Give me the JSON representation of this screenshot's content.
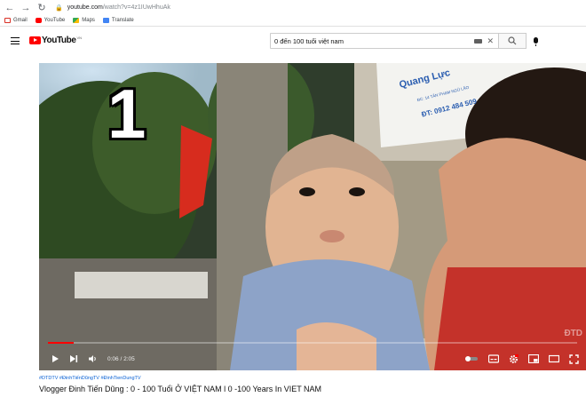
{
  "browser": {
    "url_host": "youtube.com",
    "url_path": "/watch?v=4z1IUwHhuAk",
    "bookmarks": [
      {
        "label": "Gmail",
        "icon": "gmail-icon",
        "color": "#d93025"
      },
      {
        "label": "YouTube",
        "icon": "youtube-icon",
        "color": "#ff0000"
      },
      {
        "label": "Maps",
        "icon": "maps-icon",
        "color": "#34a853"
      },
      {
        "label": "Translate",
        "icon": "translate-icon",
        "color": "#4285f4"
      }
    ]
  },
  "header": {
    "logo_text": "YouTube",
    "country_code": "VN",
    "search_value": "0 đến 100 tuổi việt nam"
  },
  "player": {
    "chapter_number": "1",
    "sign_line1": "Quang Lực",
    "sign_line2": "ĐC: 14 TÂN PHẠM NGŨ LÃO",
    "sign_line3": "ĐT: 0912 484 509",
    "watermark": "ĐTD",
    "time_current": "0:06",
    "time_total": "2:05",
    "progress_fraction": 0.048,
    "colors": {
      "progress": "#ff0000",
      "accent": "#ff0000"
    }
  },
  "video": {
    "hashtags": "#DTDTV #ĐinhTiếnDũngTV #ĐinhTienDungTV",
    "title": "Vlogger Đinh Tiến Dũng : 0 - 100 Tuổi Ở VIỆT NAM l 0 -100 Years In VIET NAM"
  }
}
